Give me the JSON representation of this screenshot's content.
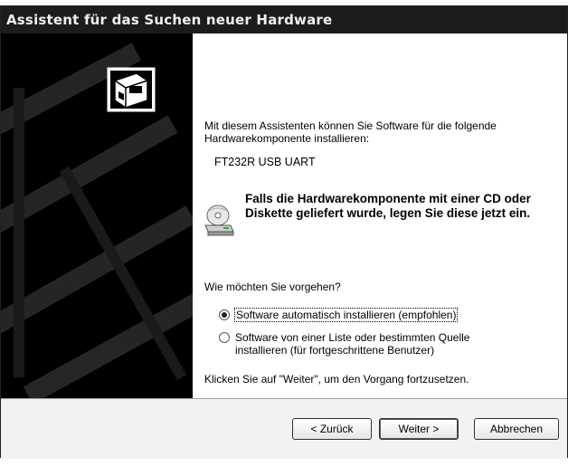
{
  "window": {
    "title": "Assistent für das Suchen neuer Hardware"
  },
  "content": {
    "intro": "Mit diesem Assistenten können Sie Software für die folgende Hardwarekomponente installieren:",
    "device_name": "FT232R USB UART",
    "cd_notice": "Falls die Hardwarekomponente mit einer CD oder Diskette geliefert wurde, legen Sie diese jetzt ein.",
    "question": "Wie möchten Sie vorgehen?",
    "options": [
      {
        "label": "Software automatisch installieren (empfohlen)",
        "selected": true
      },
      {
        "label": "Software von einer Liste oder bestimmten Quelle installieren (für fortgeschrittene Benutzer)",
        "selected": false
      }
    ],
    "continue_hint": "Klicken Sie auf \"Weiter\", um den Vorgang fortzusetzen."
  },
  "buttons": {
    "back": "< Zurück",
    "next": "Weiter >",
    "cancel": "Abbrechen"
  },
  "icons": {
    "wizard": "hardware-wizard-icon",
    "cd": "cd-drive-icon"
  },
  "colors": {
    "titlebar": "#1c1c1c",
    "sidebar": "#000000",
    "content_bg": "#ffffff",
    "button_bar": "#f2f2f2"
  }
}
